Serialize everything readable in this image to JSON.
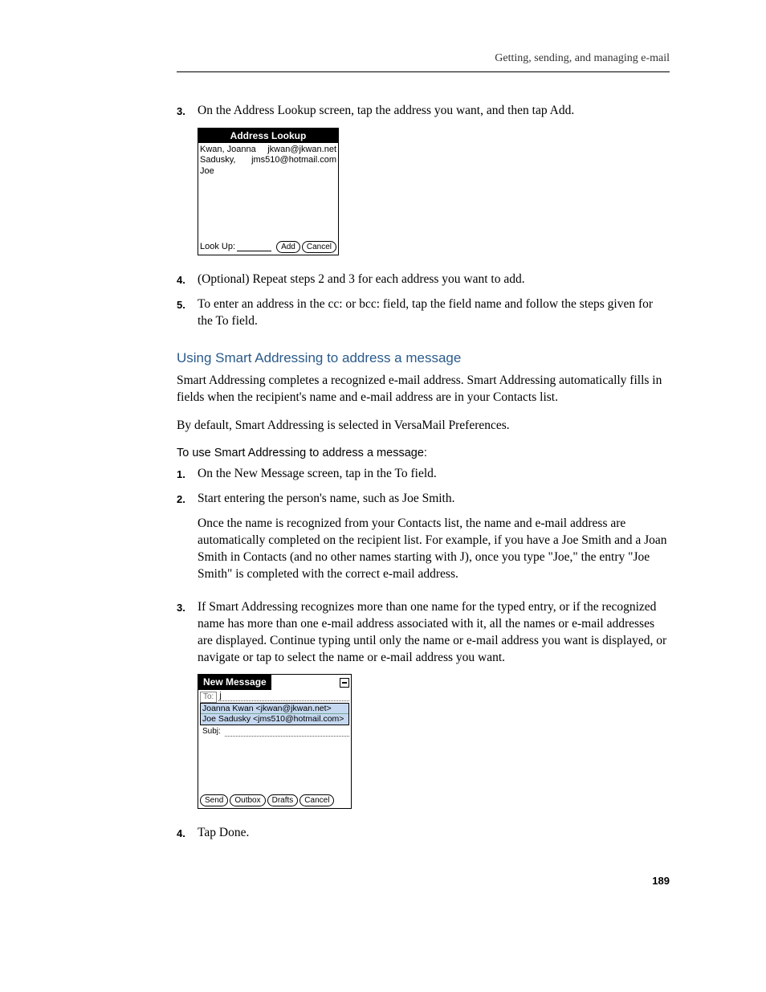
{
  "header": {
    "breadcrumb": "Getting, sending, and managing e-mail"
  },
  "step3": {
    "num": "3.",
    "text": "On the Address Lookup screen, tap the address you want, and then tap Add."
  },
  "pda_lookup": {
    "title": "Address Lookup",
    "rows": [
      {
        "name": "Kwan, Joanna",
        "email": "jkwan@jkwan.net"
      },
      {
        "name": "Sadusky, Joe",
        "email": "jms510@hotmail.com"
      }
    ],
    "lookup_label": "Look Up:",
    "add_btn": "Add",
    "cancel_btn": "Cancel"
  },
  "step4": {
    "num": "4.",
    "text": "(Optional) Repeat steps 2 and 3 for each address you want to add."
  },
  "step5": {
    "num": "5.",
    "text": "To enter an address in the cc: or bcc: field, tap the field name and follow the steps given for the To field."
  },
  "section": {
    "title": "Using Smart Addressing to address a message",
    "p1": "Smart Addressing completes a recognized e-mail address. Smart Addressing automatically fills in fields when the recipient's name and e-mail address are in your Contacts list.",
    "p2": "By default, Smart Addressing is selected in VersaMail Preferences.",
    "subhead": "To use Smart Addressing to address a message:"
  },
  "sa1": {
    "num": "1.",
    "text": "On the New Message screen, tap in the To field."
  },
  "sa2": {
    "num": "2.",
    "text": "Start entering the person's name, such as Joe Smith.",
    "text2": "Once the name is recognized from your Contacts list, the name and e-mail address are automatically completed on the recipient list. For example, if you have a Joe Smith and a Joan Smith in Contacts (and no other names starting with J), once you type \"Joe,\" the entry \"Joe Smith\" is completed with the correct e-mail address."
  },
  "sa3": {
    "num": "3.",
    "text": "If Smart Addressing recognizes more than one name for the typed entry, or if the recognized name has more than one e-mail address associated with it, all the names or e-mail addresses are displayed. Continue typing until only the name or e-mail address you want is displayed, or navigate or tap to select the name or e-mail address you want."
  },
  "pda_newmsg": {
    "title": "New Message",
    "to_label": "To:",
    "to_value": "j",
    "suggestions": [
      "Joanna Kwan <jkwan@jkwan.net>",
      "Joe Sadusky <jms510@hotmail.com>"
    ],
    "subj_label": "Subj:",
    "send_btn": "Send",
    "outbox_btn": "Outbox",
    "drafts_btn": "Drafts",
    "cancel_btn": "Cancel"
  },
  "sa4": {
    "num": "4.",
    "text": "Tap Done."
  },
  "page_number": "189"
}
